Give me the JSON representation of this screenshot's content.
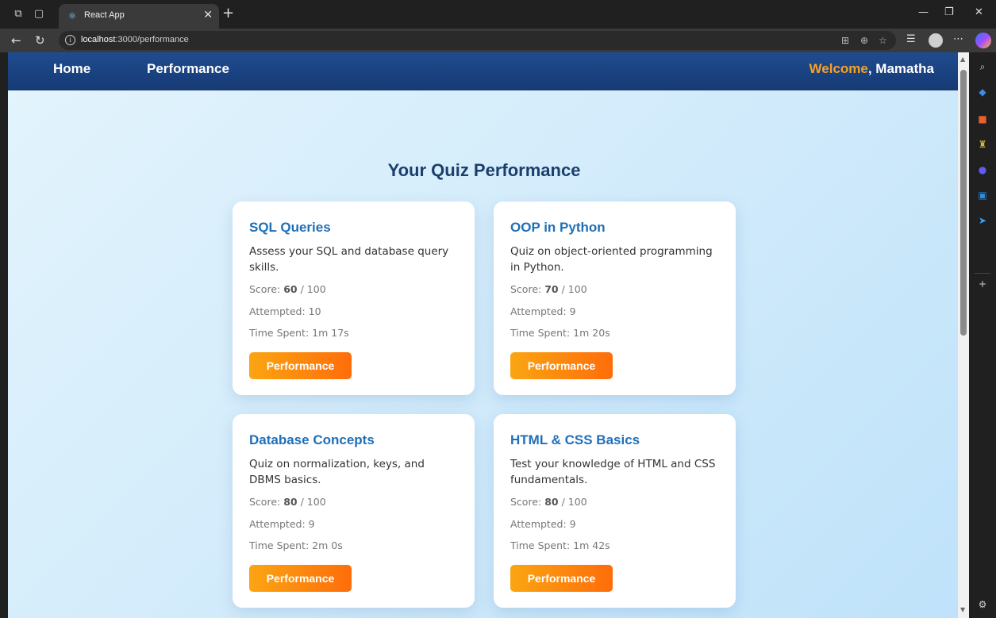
{
  "browser": {
    "tab_title": "React App",
    "url_host": "localhost",
    "url_path": ":3000/performance"
  },
  "nav": {
    "home": "Home",
    "performance": "Performance",
    "welcome_word": "Welcome",
    "welcome_rest": ", Mamatha"
  },
  "page": {
    "title": "Your Quiz Performance"
  },
  "labels": {
    "score": "Score:",
    "attempted": "Attempted:",
    "time_spent": "Time Spent:",
    "button": "Performance"
  },
  "cards": [
    {
      "title": "SQL Queries",
      "desc": "Assess your SQL and database query skills.",
      "score": "60",
      "max": "/ 100",
      "attempted": "10",
      "time": "1m 17s"
    },
    {
      "title": "OOP in Python",
      "desc": "Quiz on object-oriented programming in Python.",
      "score": "70",
      "max": "/ 100",
      "attempted": "9",
      "time": "1m 20s"
    },
    {
      "title": "Database Concepts",
      "desc": "Quiz on normalization, keys, and DBMS basics.",
      "score": "80",
      "max": "/ 100",
      "attempted": "9",
      "time": "2m 0s"
    },
    {
      "title": "HTML & CSS Basics",
      "desc": "Test your knowledge of HTML and CSS fundamentals.",
      "score": "80",
      "max": "/ 100",
      "attempted": "9",
      "time": "1m 42s"
    }
  ]
}
